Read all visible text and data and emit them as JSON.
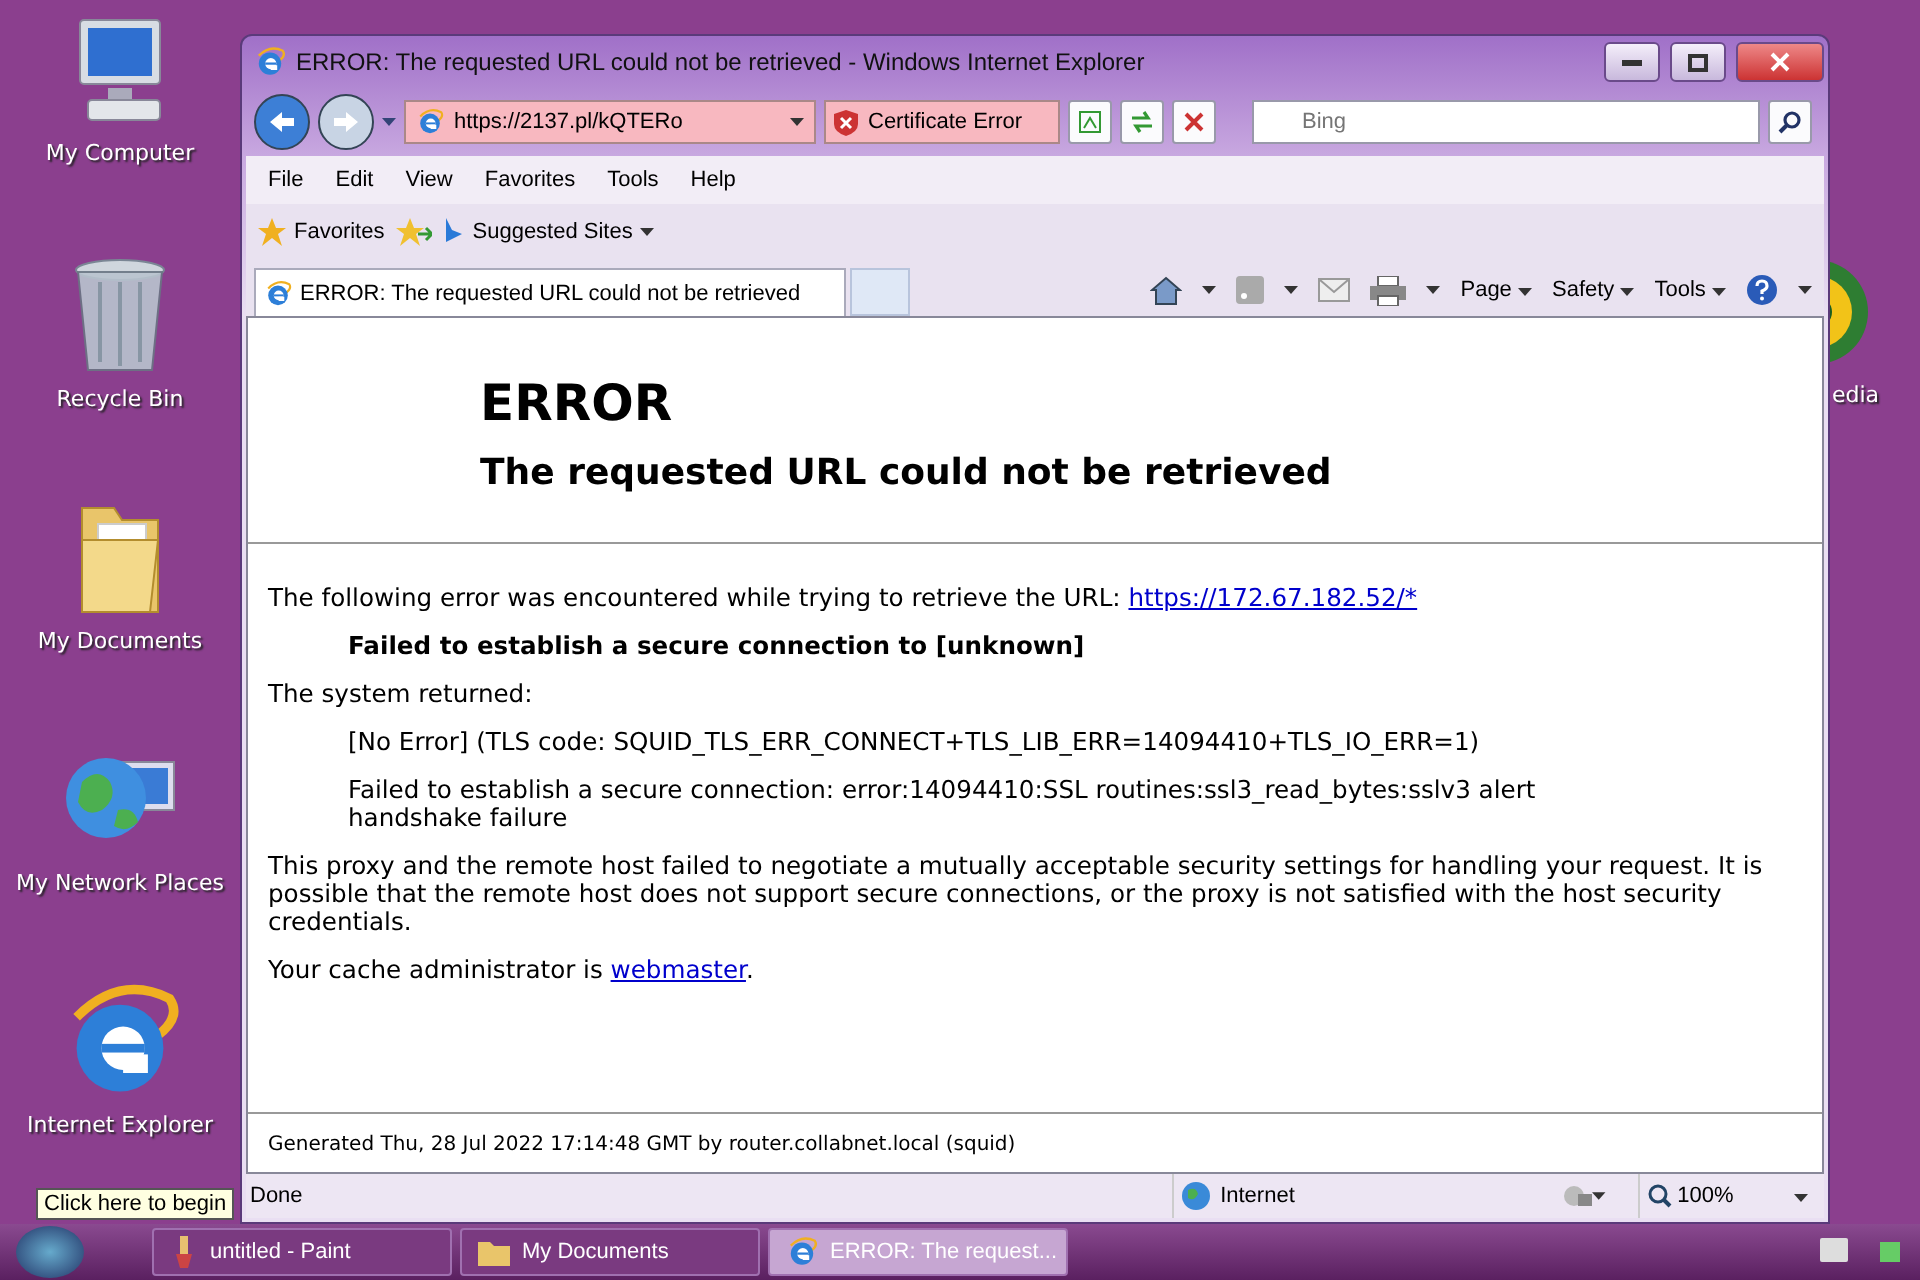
{
  "desktop_icons": [
    {
      "label": "My Computer",
      "kind": "computer"
    },
    {
      "label": "Recycle Bin",
      "kind": "bin"
    },
    {
      "label": "My Documents",
      "kind": "folder"
    },
    {
      "label": "My Network Places",
      "kind": "network"
    },
    {
      "label": "Internet Explorer",
      "kind": "ie"
    }
  ],
  "desktop_right_icon": {
    "label": "edia",
    "kind": "media"
  },
  "window": {
    "title": "ERROR: The requested URL could not be retrieved - Windows Internet Explorer"
  },
  "address_bar": {
    "url": "https://2137.pl/kQTERo",
    "certificate": "Certificate Error"
  },
  "search": {
    "placeholder": "Bing"
  },
  "menu": [
    "File",
    "Edit",
    "View",
    "Favorites",
    "Tools",
    "Help"
  ],
  "favorites_bar": {
    "favorites": "Favorites",
    "suggested": "Suggested Sites"
  },
  "tabs": [
    {
      "label": "ERROR: The requested URL could not be retrieved",
      "selected": true
    }
  ],
  "commands": [
    "Page",
    "Safety",
    "Tools"
  ],
  "page": {
    "title": "ERROR",
    "subtitle": "The requested URL could not be retrieved",
    "intro": "The following error was encountered while trying to retrieve the URL: ",
    "intro_link": "https://172.67.182.52/*",
    "error_line": "Failed to establish a secure connection to [unknown]",
    "system_returned": "The system returned:",
    "details": [
      "[No Error] (TLS code: SQUID_TLS_ERR_CONNECT+TLS_LIB_ERR=14094410+TLS_IO_ERR=1)",
      "Failed to establish a secure connection: error:14094410:SSL routines:ssl3_read_bytes:sslv3 alert handshake failure"
    ],
    "explanation": "This proxy and the remote host failed to negotiate a mutually acceptable security settings for handling your request. It is possible that the remote host does not support secure connections, or the proxy is not satisfied with the host security credentials.",
    "admin_text": "Your cache administrator is ",
    "admin_link": "webmaster",
    "admin_end": ".",
    "footer": "Generated Thu, 28 Jul 2022 17:14:48 GMT by router.collabnet.local (squid)"
  },
  "status_bar": {
    "text": "Done",
    "zone": "Internet",
    "zoom": "100%"
  },
  "tooltip": "Click here to begin",
  "taskbar": [
    {
      "label": "untitled - Paint",
      "kind": "paint",
      "selected": false
    },
    {
      "label": "My Documents",
      "kind": "folder",
      "selected": false
    },
    {
      "label": "ERROR: The request...",
      "kind": "ie",
      "selected": true
    }
  ]
}
